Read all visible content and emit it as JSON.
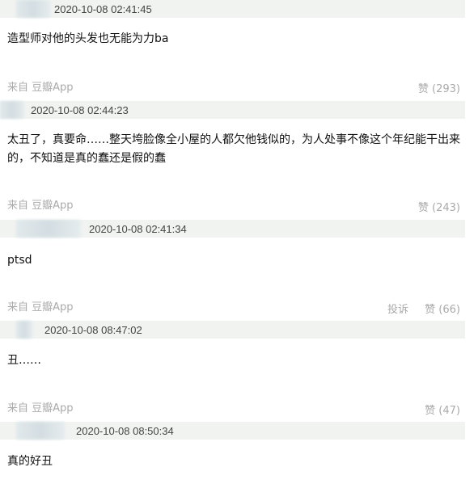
{
  "comments": [
    {
      "time": "2020-10-08 02:41:45",
      "text": "造型师对他的头发也无能为力ba",
      "source_prefix": "来自",
      "source_app": "豆瓣App",
      "report": "",
      "like": "赞 (293)"
    },
    {
      "time": "2020-10-08 02:44:23",
      "text": "太丑了，真要命……整天垮脸像全小屋的人都欠他钱似的，为人处事不像这个年纪能干出来的，不知道是真的蠢还是假的蠢",
      "source_prefix": "来自",
      "source_app": "豆瓣App",
      "report": "",
      "like": "赞 (243)"
    },
    {
      "time": "2020-10-08 02:41:34",
      "text": "ptsd",
      "source_prefix": "来自",
      "source_app": "豆瓣App",
      "report": "投诉",
      "like": "赞 (66)"
    },
    {
      "time": "2020-10-08 08:47:02",
      "text": "丑……",
      "source_prefix": "来自",
      "source_app": "豆瓣App",
      "report": "",
      "like": "赞 (47)"
    },
    {
      "time": "2020-10-08 08:50:34",
      "text": "真的好丑",
      "source_prefix": "",
      "source_app": "",
      "report": "",
      "like": ""
    }
  ]
}
